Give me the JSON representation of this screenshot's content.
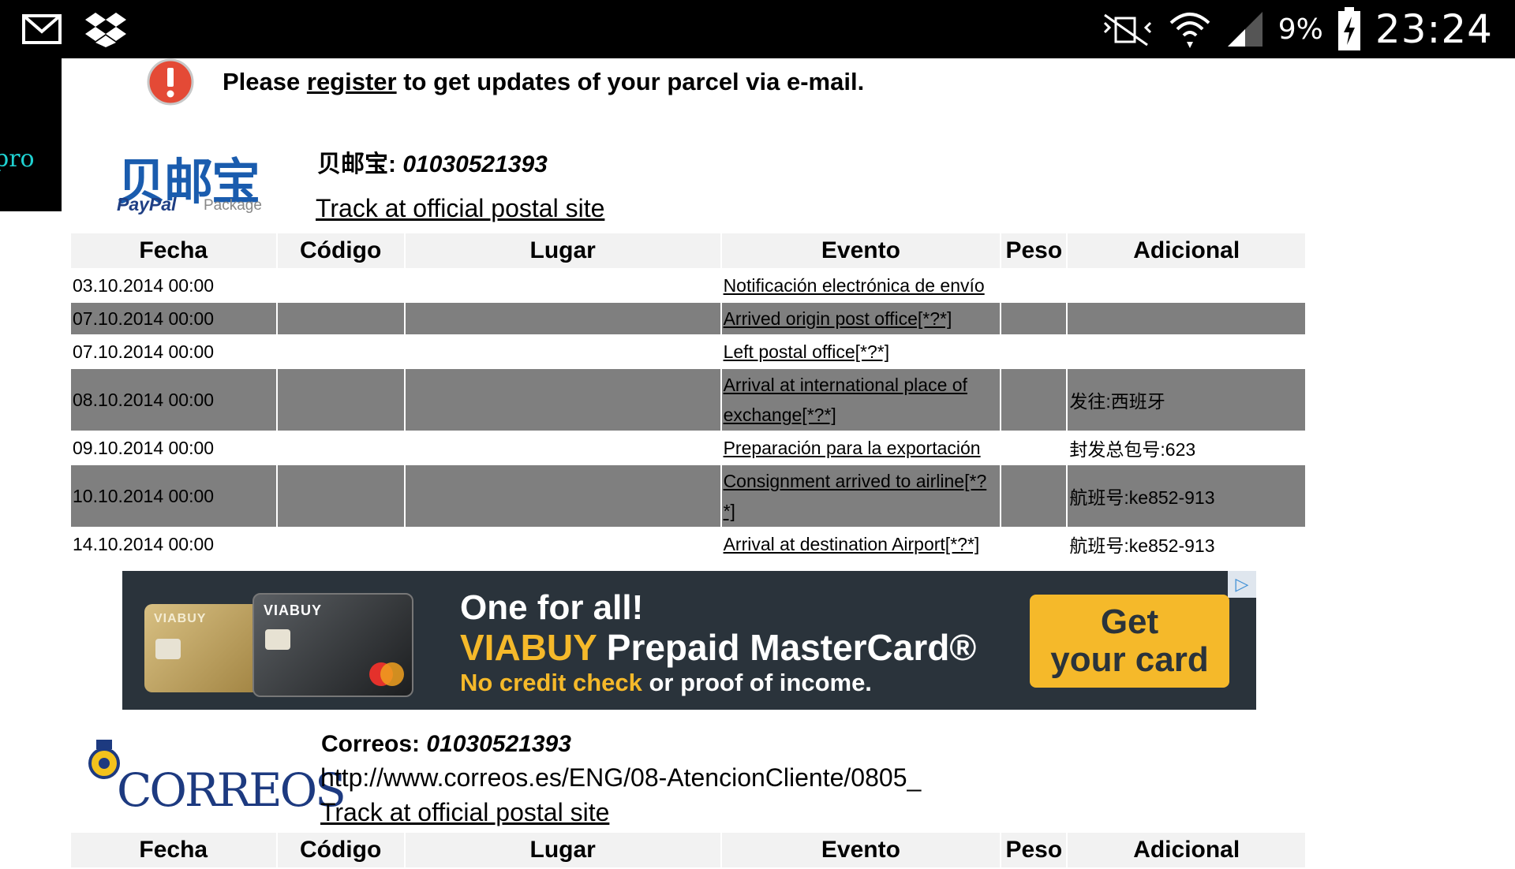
{
  "status_bar": {
    "battery_percent": "9%",
    "time": "23:24",
    "icons": [
      "gmail-icon",
      "dropbox-icon",
      "mute-icon",
      "wifi-icon",
      "signal-icon",
      "battery-charging-icon"
    ]
  },
  "side_strip_text": "pro",
  "notice": {
    "prefix": "Please ",
    "link": "register",
    "suffix": " to get updates of your parcel via e-mail."
  },
  "carriers": [
    {
      "logo_cn": "贝邮宝",
      "logo_paypal": "PayPal",
      "logo_package": "Package",
      "name": "贝邮宝",
      "number": "01030521393",
      "track_link": "Track at official postal site"
    },
    {
      "logo_text": "CORREOS",
      "name": "Correos",
      "number": "01030521393",
      "url": "http://www.correos.es/ENG/08-AtencionCliente/0805_",
      "track_link": "Track at official postal site"
    }
  ],
  "table": {
    "headers": [
      "Fecha",
      "Código",
      "Lugar",
      "Evento",
      "Peso",
      "Adicional"
    ],
    "rows": [
      {
        "fecha": "03.10.2014 00:00",
        "evento": "Notificación electrónica de envío",
        "adicional": ""
      },
      {
        "fecha": "07.10.2014 00:00",
        "evento": "Arrived origin post office[*?*]",
        "adicional": ""
      },
      {
        "fecha": "07.10.2014 00:00",
        "evento": "Left postal office[*?*]",
        "adicional": ""
      },
      {
        "fecha": "08.10.2014 00:00",
        "evento": "Arrival at international place of exchange[*?*]",
        "adicional": "发往:西班牙"
      },
      {
        "fecha": "09.10.2014 00:00",
        "evento": "Preparación para la exportación",
        "adicional": "封发总包号:623"
      },
      {
        "fecha": "10.10.2014 00:00",
        "evento": "Consignment arrived to airline[*?*]",
        "adicional": "航班号:ke852-913"
      },
      {
        "fecha": "14.10.2014 00:00",
        "evento": "Arrival at destination Airport[*?*]",
        "adicional": "航班号:ke852-913"
      }
    ]
  },
  "ad": {
    "card_brand": "VIABUY",
    "headline": "One for all!",
    "brand": "VIABUY",
    "product": " Prepaid MasterCard®",
    "sub_highlight": "No credit check",
    "sub_rest": " or proof of income.",
    "button_line1": "Get",
    "button_line2": "your card",
    "colors": {
      "background": "#2a333b",
      "accent": "#f5b92a"
    }
  }
}
